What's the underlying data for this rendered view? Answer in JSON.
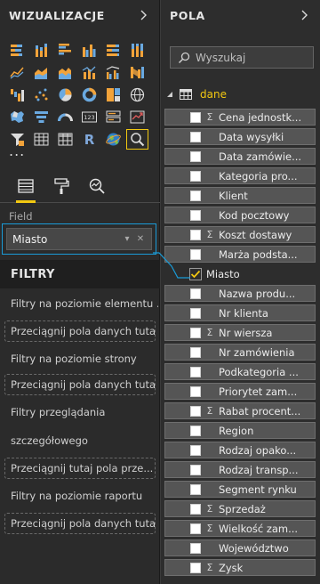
{
  "viz_pane": {
    "title": "WIZUALIZACJE",
    "more": "...",
    "field_label": "Field",
    "field_value": "Miasto",
    "tabs": [
      "fields-tab",
      "format-tab",
      "analytics-tab"
    ],
    "visuals": [
      "stacked-bar-icon",
      "stacked-column-icon",
      "clustered-bar-icon",
      "clustered-column-icon",
      "100-bar-icon",
      "100-column-icon",
      "line-icon",
      "area-icon",
      "stacked-area-icon",
      "line-column-icon",
      "line-clustered-column-icon",
      "ribbon-icon",
      "waterfall-icon",
      "scatter-icon",
      "pie-icon",
      "donut-icon",
      "treemap-icon",
      "map-icon",
      "filled-map-icon",
      "funnel-icon",
      "gauge-icon",
      "card-icon",
      "multirow-card-icon",
      "kpi-icon",
      "slicer-icon",
      "table-icon",
      "matrix-icon",
      "r-visual-icon",
      "globe-icon",
      "qna-icon"
    ]
  },
  "filters": {
    "title": "FILTRY",
    "visual_level": "Filtry na poziomie elementu ...",
    "drop_here": "Przeciągnij pola danych tutaj",
    "page_level": "Filtry na poziomie strony",
    "drillthrough_line1": "Filtry przeglądania",
    "drillthrough_line2": "szczegółowego",
    "drillthrough_drop": "Przeciągnij tutaj pola prze...",
    "report_level": "Filtry na poziomie raportu"
  },
  "fields_pane": {
    "title": "POLA",
    "search_placeholder": "Wyszukaj",
    "table_name": "dane",
    "fields": [
      {
        "name": "Cena jednostk...",
        "sigma": true,
        "checked": false
      },
      {
        "name": "Data wysyłki",
        "sigma": false,
        "checked": false
      },
      {
        "name": "Data zamówie...",
        "sigma": false,
        "checked": false
      },
      {
        "name": "Kategoria pro...",
        "sigma": false,
        "checked": false
      },
      {
        "name": "Klient",
        "sigma": false,
        "checked": false
      },
      {
        "name": "Kod pocztowy",
        "sigma": false,
        "checked": false
      },
      {
        "name": "Koszt dostawy",
        "sigma": true,
        "checked": false
      },
      {
        "name": "Marża podsta...",
        "sigma": false,
        "checked": false
      },
      {
        "name": "Miasto",
        "sigma": false,
        "checked": true
      },
      {
        "name": "Nazwa produ...",
        "sigma": false,
        "checked": false
      },
      {
        "name": "Nr klienta",
        "sigma": false,
        "checked": false
      },
      {
        "name": "Nr wiersza",
        "sigma": true,
        "checked": false
      },
      {
        "name": "Nr zamówienia",
        "sigma": false,
        "checked": false
      },
      {
        "name": "Podkategoria ...",
        "sigma": false,
        "checked": false
      },
      {
        "name": "Priorytet zam...",
        "sigma": false,
        "checked": false
      },
      {
        "name": "Rabat procent...",
        "sigma": true,
        "checked": false
      },
      {
        "name": "Region",
        "sigma": false,
        "checked": false
      },
      {
        "name": "Rodzaj opako...",
        "sigma": false,
        "checked": false
      },
      {
        "name": "Rodzaj transp...",
        "sigma": false,
        "checked": false
      },
      {
        "name": "Segment rynku",
        "sigma": false,
        "checked": false
      },
      {
        "name": "Sprzedaż",
        "sigma": true,
        "checked": false
      },
      {
        "name": "Wielkość zam...",
        "sigma": true,
        "checked": false
      },
      {
        "name": "Województwo",
        "sigma": false,
        "checked": false
      },
      {
        "name": "Zysk",
        "sigma": true,
        "checked": false
      }
    ]
  },
  "colors": {
    "accent": "#f2c811",
    "selection": "#1a9bd7",
    "icon_orange": "#f2a33a",
    "icon_blue": "#6aa9e0"
  }
}
